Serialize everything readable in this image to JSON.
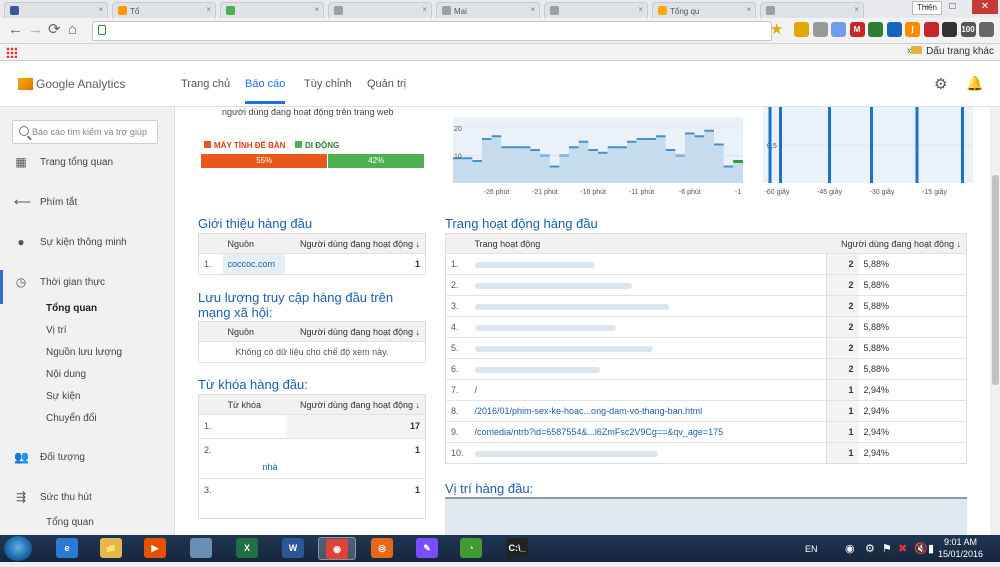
{
  "browser": {
    "tabs": [
      {
        "label": "",
        "fav": "#3b5998"
      },
      {
        "label": "Tổ",
        "fav": "#ff9800"
      },
      {
        "label": "",
        "fav": "#4caf50"
      },
      {
        "label": "",
        "fav": "#9e9e9e"
      },
      {
        "label": "Mai",
        "fav": "#9e9e9e"
      },
      {
        "label": "",
        "fav": "#9e9e9e"
      },
      {
        "label": "Tổng qu",
        "fav": "#f9ab00"
      },
      {
        "label": "",
        "fav": "#9e9e9e"
      }
    ],
    "user_badge": "Thiên",
    "window_buttons": {
      "min": "–",
      "max": "□",
      "close": "✕"
    },
    "nav": {
      "back": "←",
      "forward": "→",
      "reload": "⟳",
      "home": "⌂"
    },
    "bookmarks_folder": "Dấu trang khác",
    "bookmarks_chevron": "»",
    "extensions": [
      {
        "label": "",
        "color": "#e0a800"
      },
      {
        "label": "",
        "color": "#999"
      },
      {
        "label": "",
        "color": "#6d9eeb"
      },
      {
        "label": "M",
        "color": "#c62828"
      },
      {
        "label": "",
        "color": "#2e7d32"
      },
      {
        "label": "",
        "color": "#1565c0"
      },
      {
        "label": "ʃ",
        "color": "#fb8c00"
      },
      {
        "label": "",
        "color": "#c62828"
      },
      {
        "label": "",
        "color": "#333"
      },
      {
        "label": "100",
        "color": "#555"
      },
      {
        "label": "",
        "color": "#666"
      }
    ]
  },
  "ga": {
    "logo": "Google Analytics",
    "tabs": [
      "Trang chủ",
      "Báo cáo",
      "Tùy chỉnh",
      "Quản trị"
    ],
    "active_tab": "Báo cáo",
    "gear_icon": "⚙",
    "bell_icon": "🔔"
  },
  "sidebar": {
    "search_placeholder": "Báo cáo tìm kiếm và trợ giúp",
    "items": [
      {
        "label": "Trang tổng quan",
        "icon": "▦",
        "level": 0
      },
      {
        "label": "Phím tắt",
        "icon": "⟵",
        "level": 0
      },
      {
        "label": "Sự kiện thông minh",
        "icon": "●",
        "level": 0
      },
      {
        "label": "Thời gian thực",
        "icon": "◷",
        "level": 0
      },
      {
        "label": "Tổng quan",
        "icon": "",
        "level": 1,
        "bold": true
      },
      {
        "label": "Vị trí",
        "icon": "",
        "level": 1
      },
      {
        "label": "Nguồn lưu lượng",
        "icon": "",
        "level": 1
      },
      {
        "label": "Nội dung",
        "icon": "",
        "level": 1
      },
      {
        "label": "Sự kiện",
        "icon": "",
        "level": 1
      },
      {
        "label": "Chuyển đổi",
        "icon": "",
        "level": 1
      },
      {
        "label": "Đối tượng",
        "icon": "👥",
        "level": 0
      },
      {
        "label": "Sức thu hút",
        "icon": "⇶",
        "level": 0
      },
      {
        "label": "Tổng quan",
        "icon": "",
        "level": 1
      }
    ]
  },
  "devices": {
    "caption": "người dùng đang hoạt động trên trang web",
    "desktop_label": "MÁY TÍNH ĐỂ BÀN",
    "mobile_label": "DI ĐỘNG",
    "desktop_pct": "55%",
    "mobile_pct": "42%",
    "desktop_value": 55,
    "mobile_value": 42,
    "desktop_color": "#e8581c",
    "mobile_color": "#4caf50"
  },
  "pageviews_minute": {
    "y_ticks": [
      "20",
      "10"
    ],
    "x_ticks": [
      "-26 phút",
      "-21 phút",
      "-16 phút",
      "-11 phút",
      "-6 phút",
      "-1"
    ]
  },
  "pageviews_second": {
    "y_ticks": [
      "0,5"
    ],
    "x_ticks": [
      "-60 giây",
      "-45 giây",
      "-30 giây",
      "-15 giây"
    ]
  },
  "chart_data": [
    {
      "type": "bar",
      "title": "",
      "x": [
        "-30",
        "-29",
        "-28",
        "-27",
        "-26",
        "-25",
        "-24",
        "-23",
        "-22",
        "-21",
        "-20",
        "-19",
        "-18",
        "-17",
        "-16",
        "-15",
        "-14",
        "-13",
        "-12",
        "-11",
        "-10",
        "-9",
        "-8",
        "-7",
        "-6",
        "-5",
        "-4",
        "-3",
        "-2",
        "-1"
      ],
      "values": [
        9,
        9,
        8,
        16,
        17,
        13,
        13,
        13,
        12,
        10,
        6,
        10,
        13,
        15,
        12,
        11,
        13,
        13,
        15,
        16,
        16,
        17,
        12,
        10,
        18,
        17,
        19,
        14,
        6,
        8
      ],
      "xlabel": "",
      "ylabel": "",
      "ylim": [
        0,
        24
      ],
      "xticks": [
        "-26 phút",
        "-21 phút",
        "-16 phút",
        "-11 phút",
        "-6 phút",
        "-1"
      ],
      "yticks": [
        "20",
        "10"
      ]
    },
    {
      "type": "bar",
      "title": "",
      "x": [
        "-58",
        "-55",
        "-41",
        "-29",
        "-16",
        "-3"
      ],
      "values": [
        1,
        1,
        1,
        1,
        1,
        1
      ],
      "xlabel": "",
      "ylabel": "",
      "ylim": [
        0,
        1
      ],
      "xticks": [
        "-60 giây",
        "-45 giây",
        "-30 giây",
        "-15 giây"
      ],
      "yticks": [
        "0,5"
      ]
    }
  ],
  "referrals": {
    "title": "Giới thiệu hàng đầu",
    "col_source": "Nguồn",
    "col_active": "Người dùng đang hoạt động",
    "sort_icon": "↓",
    "rows": [
      {
        "idx": "1.",
        "name": "coccoc.com",
        "value": "1"
      }
    ]
  },
  "social": {
    "title_line1": "Lưu lượng truy cập hàng đầu trên",
    "title_line2": "mạng xã hội:",
    "col_source": "Nguồn",
    "col_active": "Người dùng đang hoạt động",
    "sort_icon": "↓",
    "empty": "Không có dữ liệu cho chế độ xem này."
  },
  "keywords": {
    "title": "Từ khóa hàng đầu:",
    "col_kw": "Từ khóa",
    "col_active": "Người dùng đang hoạt động",
    "sort_icon": "↓",
    "rows": [
      {
        "idx": "1.",
        "kw": "",
        "value": "17"
      },
      {
        "idx": "2.",
        "kw": "nhà",
        "value": "1"
      },
      {
        "idx": "3.",
        "kw": "",
        "value": "1"
      }
    ]
  },
  "pages": {
    "title": "Trang hoạt động hàng đầu",
    "col_page": "Trang hoạt động",
    "col_active": "Người dùng đang hoạt động",
    "sort_icon": "↓",
    "rows": [
      {
        "idx": "1.",
        "page": "",
        "value": "2",
        "pct": "5,88%"
      },
      {
        "idx": "2.",
        "page": "",
        "value": "2",
        "pct": "5,88%"
      },
      {
        "idx": "3.",
        "page": "",
        "value": "2",
        "pct": "5,88%"
      },
      {
        "idx": "4.",
        "page": "",
        "value": "2",
        "pct": "5,88%"
      },
      {
        "idx": "5.",
        "page": "",
        "value": "2",
        "pct": "5,88%"
      },
      {
        "idx": "6.",
        "page": "",
        "value": "2",
        "pct": "5,88%"
      },
      {
        "idx": "7.",
        "page": "/",
        "value": "1",
        "pct": "2,94%"
      },
      {
        "idx": "8.",
        "page": "/2016/01/phim-sex-ke-hoac...ong-dam-vo-thang-ban.html",
        "value": "1",
        "pct": "2,94%"
      },
      {
        "idx": "9.",
        "page": "/comedia/ntrb?id=6587554&...l6ZmFsc2V9Cg==&qv_age=175",
        "value": "1",
        "pct": "2,94%"
      },
      {
        "idx": "10.",
        "page": "",
        "value": "1",
        "pct": "2,94%"
      }
    ]
  },
  "locations": {
    "title": "Vị trí hàng đầu:"
  },
  "taskbar": {
    "apps": [
      {
        "label": "e",
        "color": "#2a7bd4"
      },
      {
        "label": "📁",
        "color": "#e4b84d"
      },
      {
        "label": "▶",
        "color": "#e65100"
      },
      {
        "label": "",
        "color": "#6a8fb5"
      },
      {
        "label": "X",
        "color": "#1e7145"
      },
      {
        "label": "W",
        "color": "#2b579a"
      },
      {
        "label": "◉",
        "color": "#db4437"
      },
      {
        "label": "◎",
        "color": "#e8681a"
      },
      {
        "label": "✎",
        "color": "#7c4dff"
      },
      {
        "label": "◔",
        "color": "#3f9b32"
      },
      {
        "label": "C:\\_",
        "color": "#222"
      }
    ],
    "active_app": 6,
    "lang": "EN",
    "time": "9:01 AM",
    "date": "15/01/2016"
  }
}
